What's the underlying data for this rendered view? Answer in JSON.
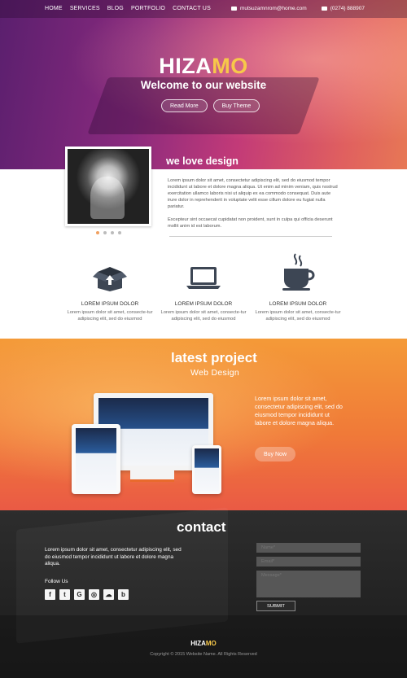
{
  "nav": {
    "items": [
      "HOME",
      "SERVICES",
      "BLOG",
      "PORTFOLIO",
      "CONTACT US"
    ],
    "email": "mutsuzamnrom@home.com",
    "phone": "(0274) 888907"
  },
  "hero": {
    "logo_main": "HIZA",
    "logo_accent": "MO",
    "welcome": "Welcome to our website",
    "read_more": "Read More",
    "buy_theme": "Buy Theme"
  },
  "about": {
    "title": "we love design",
    "paragraph1": "Lorem ipsum dolor sit amet, consectetur adipiscing elit, sed do eiusmod tempor incididunt ut labore et dolore magna aliqua. Ut enim ad minim veniam, quis nostrud exercitation ullamco laboris nisi ut aliquip ex ea commodo consequat. Duis aute irure dolor in reprehenderit in voluptate velit esse cillum dolore eu fugiat nulla pariatur.",
    "paragraph2": "Excepteur sint occaecat cupidatat non proident, sunt in culpa qui officia deserunt mollit anim id est laborum."
  },
  "features": [
    {
      "title": "LOREM IPSUM DOLOR",
      "text": "Lorem ipsum dolor sit amet, consecte-tur adipiscing elit, sed do eiusmod",
      "icon": "box-icon"
    },
    {
      "title": "LOREM IPSUM DOLOR",
      "text": "Lorem ipsum dolor sit amet, consecte-tur adipiscing elit, sed do eiusmod",
      "icon": "laptop-icon"
    },
    {
      "title": "LOREM IPSUM DOLOR",
      "text": "Lorem ipsum dolor sit amet, consecte-tur adipiscing elit, sed do eiusmod",
      "icon": "coffee-icon"
    }
  ],
  "project": {
    "title": "latest project",
    "subtitle": "Web Design",
    "text": "Lorem ipsum dolor sit amet, consectetur adipiscing elit, sed do eiusmod tempor incididunt ut labore et dolore magna aliqua.",
    "button": "Buy Now"
  },
  "contact": {
    "title": "contact",
    "text": "Lorem ipsum dolor sit amet, consectetur adipiscing elit, sed do eiusmod tempor incididunt ut labore et dolore magna aliqua.",
    "follow": "Follow Us",
    "socials": [
      "f",
      "t",
      "G",
      "◎",
      "☁",
      "b"
    ],
    "name_placeholder": "Name*",
    "email_placeholder": "Email*",
    "message_placeholder": "Message*",
    "submit": "SUBMIT"
  },
  "footer": {
    "logo_main": "HIZA",
    "logo_accent": "MO",
    "copyright": "Copyright © 2015 Website Name. All Rights Reserved"
  },
  "colors": {
    "accent_yellow": "#f7c84a",
    "hero_purple": "#5a1f6e",
    "project_orange": "#f07a38",
    "contact_dark": "#222222"
  }
}
